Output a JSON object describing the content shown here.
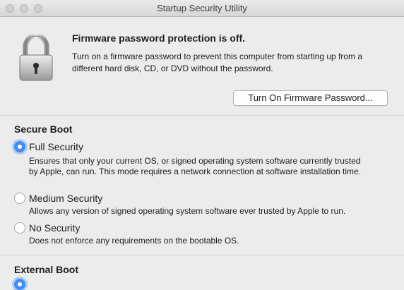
{
  "window": {
    "title": "Startup Security Utility"
  },
  "firmware": {
    "heading": "Firmware password protection is off.",
    "description": "Turn on a firmware password to prevent this computer from starting up from a different hard disk, CD, or DVD without the password.",
    "button_label": "Turn On Firmware Password..."
  },
  "secure_boot": {
    "title": "Secure Boot",
    "options": [
      {
        "label": "Full Security",
        "description": "Ensures that only your current OS, or signed operating system software currently trusted by Apple, can run. This mode requires a network connection at software installation time.",
        "selected": true
      },
      {
        "label": "Medium Security",
        "description": "Allows any version of signed operating system software ever trusted by Apple to run.",
        "selected": false
      },
      {
        "label": "No Security",
        "description": "Does not enforce any requirements on the bootable OS.",
        "selected": false
      }
    ]
  },
  "external_boot": {
    "title": "External Boot"
  },
  "colors": {
    "accent": "#3f8ff7",
    "background": "#ececec"
  }
}
